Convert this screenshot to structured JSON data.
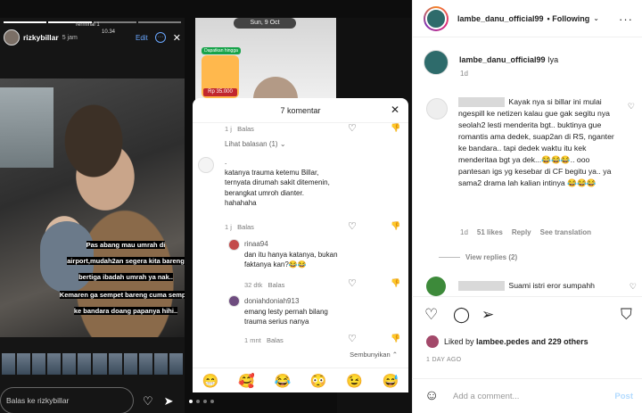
{
  "story": {
    "username": "rizkybillar",
    "time": "5 jam",
    "location_line1": "Terminal 1",
    "location_line2": "10.34",
    "edit_label": "Edit",
    "caption": [
      "Pas abang mau umrah di airport,mudah2an segera kita bareng bertiga ibadah umrah ya nak..",
      "Kemaren ga sempet bareng cuma sempet ke bandara doang papanya hihi.."
    ],
    "reply_placeholder": "Balas ke rizkybillar",
    "date_pill": "Sun, 9 Oct",
    "promo_tag": "Dapatkan hingga",
    "promo_price": "Rp 35.000"
  },
  "sheet": {
    "title": "7 komentar",
    "c0": {
      "time": "1 j",
      "reply": "Balas"
    },
    "view_replies": "Lihat balasan (1)",
    "c1": {
      "lines": [
        "katanya trauma ketemu Billar,",
        "ternyata dirumah sakit ditemenin,",
        "berangkat umroh dianter.",
        "hahahaha"
      ],
      "time": "1 j",
      "reply": "Balas"
    },
    "c2": {
      "user": "rinaa94",
      "text": "dan itu hanya katanya, bukan faktanya kan?😂😂",
      "time": "32 dtk",
      "reply": "Balas"
    },
    "c3": {
      "user": "doniahdoniah913",
      "text": "emang lesty pernah bilang trauma serius nanya",
      "time": "1 mnt",
      "reply": "Balas"
    },
    "hide_label": "Sembunyikan",
    "emojis": [
      "😁",
      "🥰",
      "😂",
      "😳",
      "😉",
      "😅"
    ]
  },
  "panel": {
    "username": "lambe_danu_official99",
    "follow_label": "Following",
    "caption_text": "Iya",
    "caption_age": "1d",
    "comment": {
      "text": "Kayak nya si billar ini mulai ngespill ke netizen kalau gue gak segitu nya seolah2 lesti menderita bgt.. buktinya gue romantis ama dedek, suap2an di RS, nganter ke bandara.. tapi dedek waktu itu kek menderitaa bgt ya dek...😂😂😂.. ooo pantesan igs yg kesebar di CF begitu ya.. ya sama2 drama lah kalian intinya 😂😂😂",
      "age": "1d",
      "likes": "51 likes",
      "reply": "Reply",
      "translate": "See translation"
    },
    "view_replies": "View replies (2)",
    "comment2_text": "Suami istri eror sumpahh",
    "liked_by_prefix": "Liked by",
    "liked_by_user": "lambee.pedes",
    "liked_by_suffix": "and 229 others",
    "post_age": "1 DAY AGO",
    "add_comment_placeholder": "Add a comment...",
    "post_label": "Post"
  }
}
